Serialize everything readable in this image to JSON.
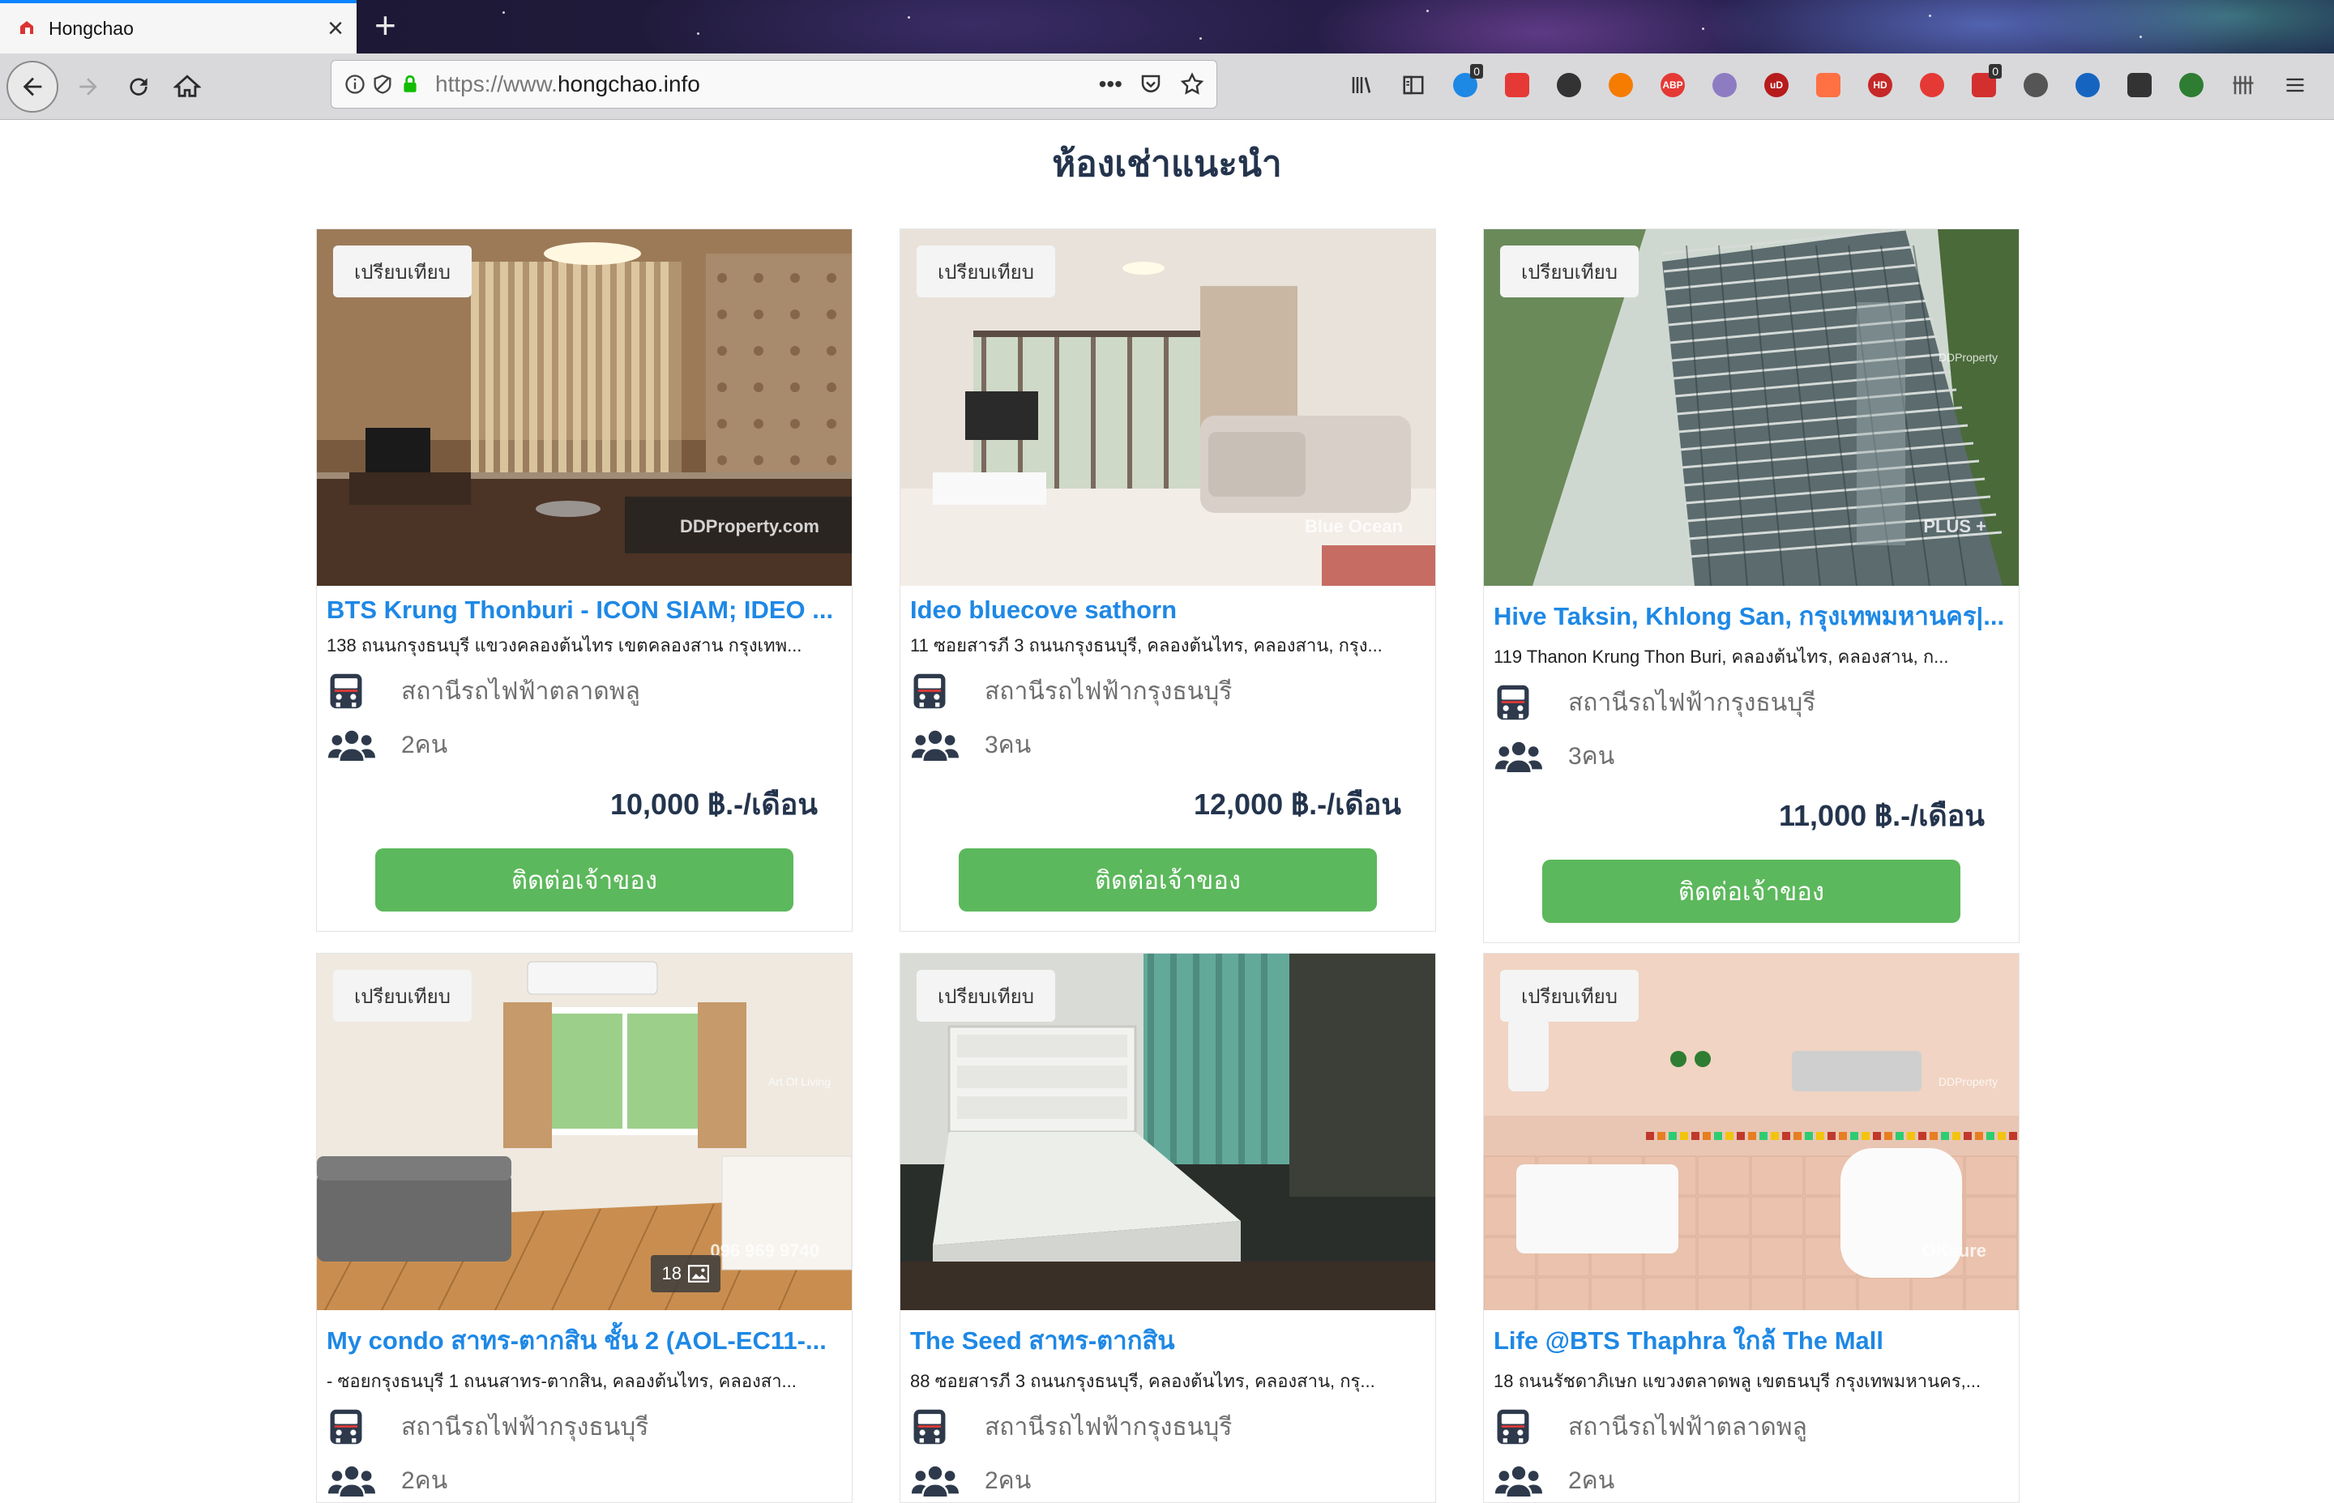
{
  "browser": {
    "tab_title": "Hongchao",
    "url_prefix": "https://www.",
    "url_domain": "hongchao.info",
    "new_tab_label": "+",
    "close_label": "×",
    "page_actions_label": "•••"
  },
  "extensions": [
    {
      "name": "library-icon"
    },
    {
      "name": "sidebar-icon"
    },
    {
      "name": "ext-bookmark-icon",
      "badge": "0",
      "color": "#1e88e5"
    },
    {
      "name": "ext-red-icon",
      "color": "#e53935"
    },
    {
      "name": "ext-colorballs-icon",
      "color": "#333333"
    },
    {
      "name": "ext-orange-icon",
      "color": "#f57c00"
    },
    {
      "name": "adblock-plus-icon",
      "text": "ABP",
      "color": "#e53935"
    },
    {
      "name": "ext-heart-icon",
      "color": "#8e7cc3"
    },
    {
      "name": "ublock-origin-icon",
      "text": "uD",
      "color": "#b71c1c"
    },
    {
      "name": "ext-star-icon",
      "color": "#ff7043"
    },
    {
      "name": "ext-hd-icon",
      "text": "HD",
      "color": "#c62828"
    },
    {
      "name": "ext-opera-icon",
      "color": "#e53935"
    },
    {
      "name": "ext-block-icon",
      "badge": "0",
      "color": "#d32f2f"
    },
    {
      "name": "ext-chat-icon",
      "color": "#555555"
    },
    {
      "name": "ext-pin-icon",
      "color": "#1565c0"
    },
    {
      "name": "github-icon",
      "color": "#333333"
    },
    {
      "name": "ext-evernote-icon",
      "color": "#2e7d32"
    },
    {
      "name": "ext-grid-icon",
      "color": "#555555"
    },
    {
      "name": "menu-icon",
      "color": "#333333"
    }
  ],
  "page": {
    "section_title": "ห้องเช่าแนะนำ",
    "compare_label": "เปรียบเทียบ",
    "contact_label": "ติดต่อเจ้าของ"
  },
  "listings": [
    {
      "name": "BTS Krung Thonburi - ICON SIAM; IDEO ...",
      "address": "138 ถนนกรุงธนบุรี แขวงคลองต้นไทร เขตคลองสาน กรุงเทพ...",
      "station": "สถานีรถไฟฟ้าตลาดพลู",
      "occupancy": "2คน",
      "price": "10,000 ฿.-/เดือน",
      "watermark": "DDProperty.com",
      "photo": "room-living"
    },
    {
      "name": "Ideo bluecove sathorn",
      "address": "11 ซอยสารภี 3 ถนนกรุงธนบุรี, คลองต้นไทร, คลองสาน, กรุง...",
      "station": "สถานีรถไฟฟ้ากรุงธนบุรี",
      "occupancy": "3คน",
      "price": "12,000 ฿.-/เดือน",
      "watermark": "Blue Ocean",
      "photo": "room-bright"
    },
    {
      "name": "Hive Taksin, Khlong San, กรุงเทพมหานคร|...",
      "address": "119 Thanon Krung Thon Buri, คลองต้นไทร, คลองสาน, ก...",
      "station": "สถานีรถไฟฟ้ากรุงธนบุรี",
      "occupancy": "3คน",
      "price": "11,000 ฿.-/เดือน",
      "watermark": "PLUS +",
      "watermark2": "DDProperty",
      "photo": "building"
    },
    {
      "name": "My condo สาทร-ตากสิน ชั้น 2 (AOL-EC11-...",
      "address": "- ซอยกรุงธนบุรี 1 ถนนสาทร-ตากสิน, คลองต้นไทร, คลองสา...",
      "station": "สถานีรถไฟฟ้ากรุงธนบุรี",
      "occupancy": "2คน",
      "price": "",
      "watermark": "096 969 9740",
      "watermark2": "Art Of Living",
      "photo_count": "18",
      "photo": "room-window"
    },
    {
      "name": "The Seed สาทร-ตากสิน",
      "address": "88 ซอยสารภี 3 ถนนกรุงธนบุรี, คลองต้นไทร, คลองสาน, กรุ...",
      "station": "สถานีรถไฟฟ้ากรุงธนบุรี",
      "occupancy": "2คน",
      "price": "",
      "photo": "room-bed"
    },
    {
      "name": "Life @BTS Thaphra ใกล้ The Mall",
      "address": "18 ถนนรัชดาภิเษก แขวงตลาดพลู เขตธนบุรี กรุงเทพมหานคร,...",
      "station": "สถานีรถไฟฟ้าตลาดพลู",
      "occupancy": "2คน",
      "price": "",
      "watermark": "OKsure",
      "watermark2": "DDProperty",
      "photo": "bathroom"
    }
  ]
}
